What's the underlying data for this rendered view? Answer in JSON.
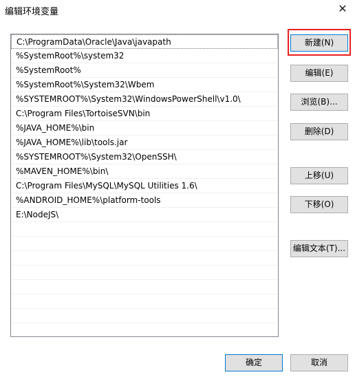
{
  "window": {
    "title": "编辑环境变量",
    "close_glyph": "✕"
  },
  "paths": [
    "C:\\ProgramData\\Oracle\\Java\\javapath",
    "%SystemRoot%\\system32",
    "%SystemRoot%",
    "%SystemRoot%\\System32\\Wbem",
    "%SYSTEMROOT%\\System32\\WindowsPowerShell\\v1.0\\",
    "C:\\Program Files\\TortoiseSVN\\bin",
    "%JAVA_HOME%\\bin",
    "%JAVA_HOME%\\lib\\tools.jar",
    "%SYSTEMROOT%\\System32\\OpenSSH\\",
    "%MAVEN_HOME%\\bin\\",
    "C:\\Program Files\\MySQL\\MySQL Utilities 1.6\\",
    "%ANDROID_HOME%\\platform-tools",
    "E:\\NodeJS\\"
  ],
  "buttons": {
    "new": "新建(N)",
    "edit": "编辑(E)",
    "browse": "浏览(B)...",
    "delete": "删除(D)",
    "up": "上移(U)",
    "down": "下移(O)",
    "edit_text": "编辑文本(T)...",
    "ok": "确定",
    "cancel": "取消"
  }
}
